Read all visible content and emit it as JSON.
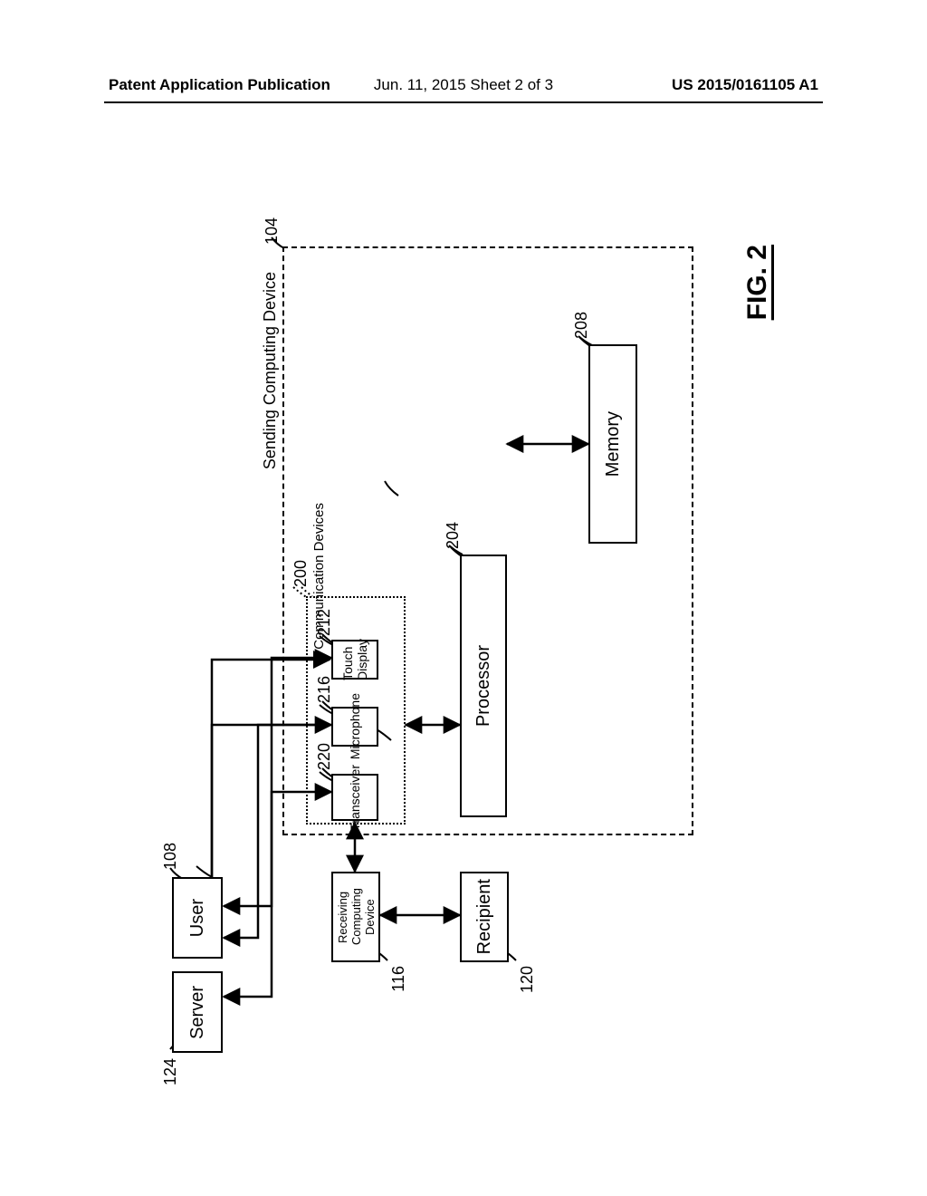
{
  "header": {
    "left": "Patent Application Publication",
    "center": "Jun. 11, 2015  Sheet 2 of 3",
    "right": "US 2015/0161105 A1"
  },
  "figure_label": "FIG. 2",
  "device_group_title": "Sending Computing Device",
  "comm_group_title": "Communication Devices",
  "blocks": {
    "user": "User",
    "server": "Server",
    "touch_display": "Touch Display",
    "microphone": "Microphone",
    "transceiver": "Transceiver",
    "processor": "Processor",
    "memory": "Memory",
    "receiving_device": "Receiving Computing Device",
    "recipient": "Recipient"
  },
  "refs": {
    "r104": "104",
    "r108": "108",
    "r124": "124",
    "r200": "200",
    "r212": "212",
    "r216": "216",
    "r220": "220",
    "r204": "204",
    "r208": "208",
    "r116": "116",
    "r120": "120"
  }
}
